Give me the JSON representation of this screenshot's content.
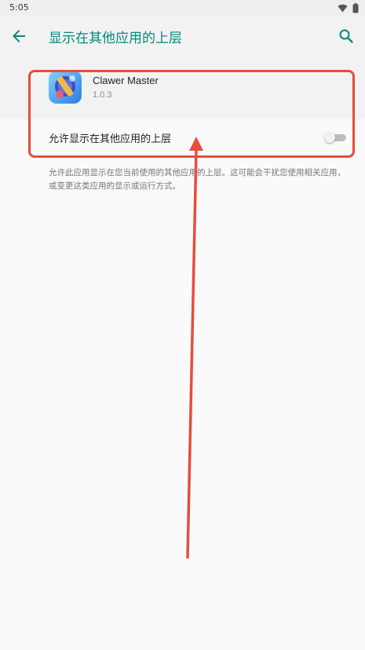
{
  "status_bar": {
    "time": "5:05"
  },
  "app_bar": {
    "title": "显示在其他应用的上层"
  },
  "app_info": {
    "name": "Clawer Master",
    "version": "1.0.3"
  },
  "setting": {
    "label": "允许显示在其他应用的上层",
    "enabled": false
  },
  "description": "允许此应用显示在您当前使用的其他应用的上层。这可能会干扰您使用相关应用，或变更这类应用的显示或运行方式。",
  "colors": {
    "accent": "#00897b",
    "annotation": "#e74c3c"
  },
  "icons": {
    "back": "arrow-back-icon",
    "search": "search-icon",
    "wifi": "wifi-icon",
    "battery": "battery-icon"
  }
}
